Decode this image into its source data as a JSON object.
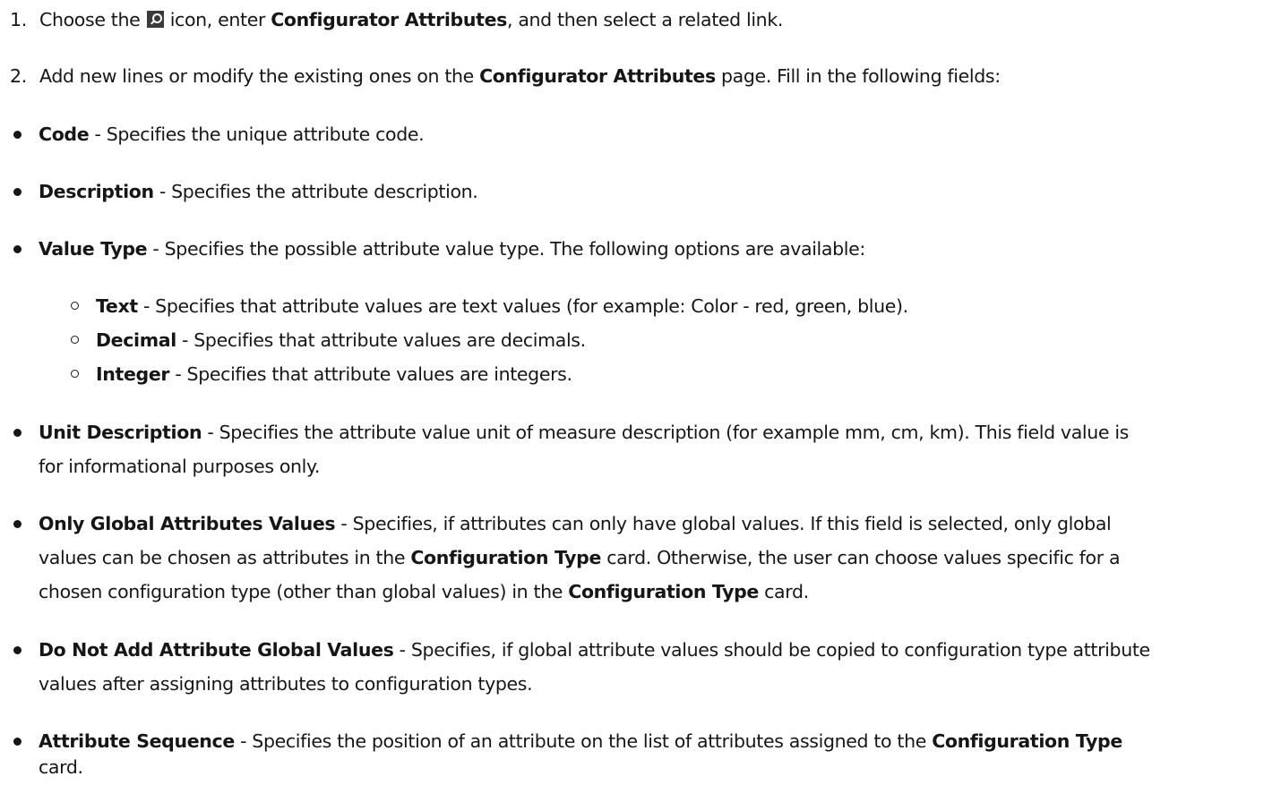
{
  "steps": [
    {
      "num": "1.",
      "pre": "Choose the",
      "icon": "search-icon",
      "mid": "icon, enter",
      "bold": "Configurator Attributes",
      "post": ", and then select a related link."
    },
    {
      "num": "2.",
      "pre": "Add new lines or modify the existing ones on the",
      "bold": "Configurator Attributes",
      "post": "page. Fill in the following fields:"
    }
  ],
  "fields": {
    "code": {
      "name": "Code",
      "desc": "- Specifies the unique attribute code."
    },
    "description": {
      "name": "Description",
      "desc": "- Specifies the attribute description."
    },
    "value_type": {
      "name": "Value Type",
      "desc": "- Specifies the possible attribute value type. The following options are available:",
      "options": [
        {
          "name": "Text",
          "desc": "- Specifies that attribute values are text values (for example: Color - red, green, blue)."
        },
        {
          "name": "Decimal",
          "desc": "- Specifies that attribute values are decimals."
        },
        {
          "name": "Integer",
          "desc": "- Specifies that attribute values are integers."
        }
      ]
    },
    "unit_description": {
      "name": "Unit Description",
      "desc1": "- Specifies the attribute value unit of measure description (for example mm, cm, km). This field value is",
      "desc2": "for informational purposes only."
    },
    "only_global": {
      "name": "Only Global Attributes Values",
      "desc1": "- Specifies, if attributes can only have global values. If this field is selected, only global",
      "l2a": "values can be chosen as attributes in the",
      "l2b": "Configuration Type",
      "l2c": "card. Otherwise, the user can choose values specific for a",
      "l3a": "chosen configuration type (other than global values) in the",
      "l3b": "Configuration Type",
      "l3c": "card."
    },
    "do_not_add": {
      "name": "Do Not Add Attribute Global Values",
      "desc1": "- Specifies, if global attribute values should be copied to configuration type attribute",
      "desc2": "values after assigning attributes to configuration types."
    },
    "attribute_sequence": {
      "name": "Attribute Sequence",
      "desc1": "- Specifies the position of an attribute on the list of attributes assigned to the",
      "bold": "Configuration Type",
      "desc2": "card."
    }
  }
}
